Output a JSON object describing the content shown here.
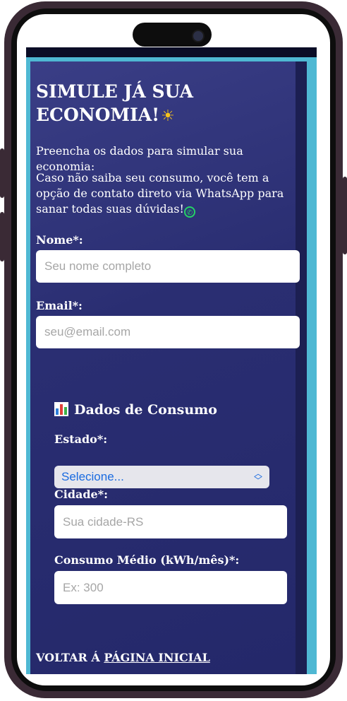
{
  "title_line1": "SIMULE JÁ SUA",
  "title_line2": "ECONOMIA!",
  "intro_text": "Preencha os dados para simular sua economia:",
  "info_text": "Caso não saiba seu consumo, você tem a opção de contato direto via WhatsApp para sanar todas suas dúvidas!",
  "form": {
    "name_label": "Nome*:",
    "name_placeholder": "Seu nome completo",
    "email_label": "Email*:",
    "email_placeholder": "seu@email.com"
  },
  "consumo": {
    "section_title": "Dados de Consumo",
    "estado_label": "Estado*:",
    "estado_selected": "Selecione...",
    "cidade_label": "Cidade*:",
    "cidade_placeholder": "Sua cidade-RS",
    "consumo_label": "Consumo Médio (kWh/mês)*:",
    "consumo_placeholder": "Ex: 300"
  },
  "footer": {
    "prefix": "VOLTAR Á ",
    "link_text": "PÁGINA INICIAL"
  },
  "icons": {
    "title_icon": "sun-icon",
    "whatsapp_icon": "whatsapp-icon",
    "section_icon": "bar-chart-icon"
  },
  "colors": {
    "background": "#2a2e72",
    "accent": "#4fb8d3",
    "select_text": "#1a6be0",
    "sun": "#f6c21b",
    "whatsapp": "#25d366"
  }
}
